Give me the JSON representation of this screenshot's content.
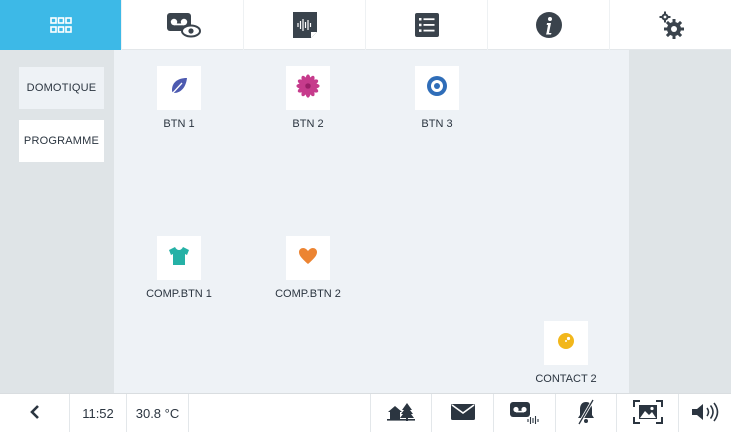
{
  "top_tabs": [
    {
      "name": "home",
      "icon": "apps-grid-icon",
      "active": true
    },
    {
      "name": "video-intercom",
      "icon": "voicemail-eye-icon",
      "active": false
    },
    {
      "name": "audio-memo",
      "icon": "audio-file-icon",
      "active": false
    },
    {
      "name": "list",
      "icon": "list-icon",
      "active": false
    },
    {
      "name": "info",
      "icon": "info-icon",
      "active": false
    },
    {
      "name": "settings",
      "icon": "gears-icon",
      "active": false
    }
  ],
  "sidebar": {
    "items": [
      {
        "label": "DOMOTIQUE",
        "selected": true
      },
      {
        "label": "PROGRAMME",
        "selected": false
      }
    ]
  },
  "tiles": [
    {
      "label": "BTN 1",
      "icon": "leaf-icon",
      "color": "#4d5ab0"
    },
    {
      "label": "BTN 2",
      "icon": "flower-icon",
      "color": "#c63b8c"
    },
    {
      "label": "BTN 3",
      "icon": "target-icon",
      "color": "#2f6db8"
    },
    {
      "label": "COMP.BTN 1",
      "icon": "tshirt-icon",
      "color": "#25b1a6"
    },
    {
      "label": "COMP.BTN 2",
      "icon": "heart-icon",
      "color": "#ec8432"
    },
    {
      "label": "CONTACT 2",
      "icon": "contact-dot-icon",
      "color": "#f2b71b"
    }
  ],
  "statusbar": {
    "back_icon": "chevron-left-icon",
    "time": "11:52",
    "temperature": "30.8 °C",
    "icons": [
      "home-tree-icon",
      "mail-icon",
      "voicemail-audio-icon",
      "bell-muted-icon",
      "photo-frame-icon",
      "speaker-icon"
    ]
  },
  "colors": {
    "accent": "#3db9e7",
    "text": "#2b3540",
    "panel": "#eef2f6",
    "side": "#dfe4e7"
  }
}
